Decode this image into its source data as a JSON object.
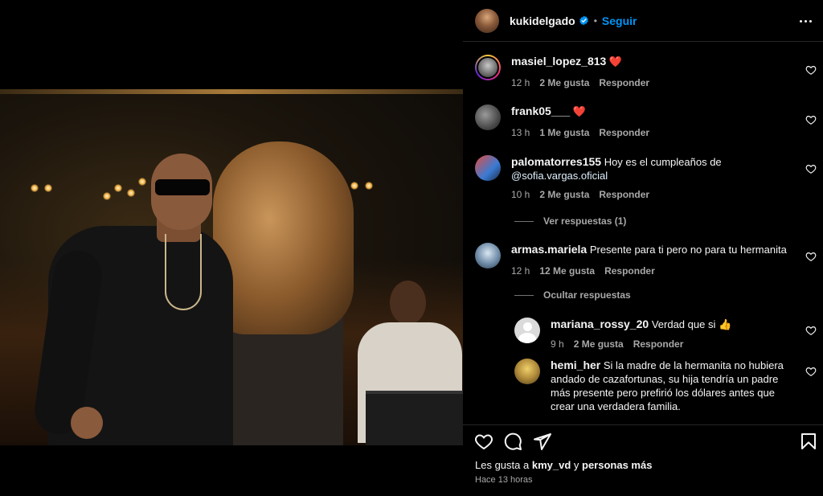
{
  "post": {
    "author": "kukidelgado",
    "follow_label": "Seguir",
    "separator": "•"
  },
  "comments": [
    {
      "user": "masiel_lopez_813",
      "text": "",
      "emoji": "❤️",
      "time": "12 h",
      "likes": "2 Me gusta",
      "reply": "Responder"
    },
    {
      "user": "frank05___",
      "text": "",
      "emoji": "❤️",
      "time": "13 h",
      "likes": "1 Me gusta",
      "reply": "Responder"
    },
    {
      "user": "palomatorres155",
      "text": "Hoy es el cumpleaños de",
      "mention": "@sofia.vargas.oficial",
      "time": "10 h",
      "likes": "2 Me gusta",
      "reply": "Responder",
      "view_replies": "Ver respuestas (1)"
    },
    {
      "user": "armas.mariela",
      "text": "Presente para ti pero no para tu hermanita",
      "time": "12 h",
      "likes": "12 Me gusta",
      "reply": "Responder",
      "hide_replies": "Ocultar respuestas"
    }
  ],
  "replies": [
    {
      "user": "mariana_rossy_20",
      "text": "Verdad que si",
      "emoji": "👍",
      "time": "9 h",
      "likes": "2 Me gusta",
      "reply": "Responder"
    },
    {
      "user": "hemi_her",
      "text": "Si la madre de la hermanita no hubiera andado de cazafortunas, su hija tendría un padre más presente pero prefirió los dólares antes que crear una verdadera familia."
    }
  ],
  "footer": {
    "likes_prefix": "Les gusta a",
    "liker": "kmy_vd",
    "conj": "y",
    "others": "personas más",
    "time": "Hace 13 horas"
  },
  "icons": {
    "verified": "verified-badge-icon",
    "more": "more-options-icon",
    "like": "heart-icon",
    "comment": "comment-icon",
    "share": "share-icon",
    "save": "bookmark-icon"
  },
  "colors": {
    "accent": "#0095f6",
    "heart": "#ed4956",
    "text": "#f5f5f5",
    "muted": "#a8a8a8"
  }
}
